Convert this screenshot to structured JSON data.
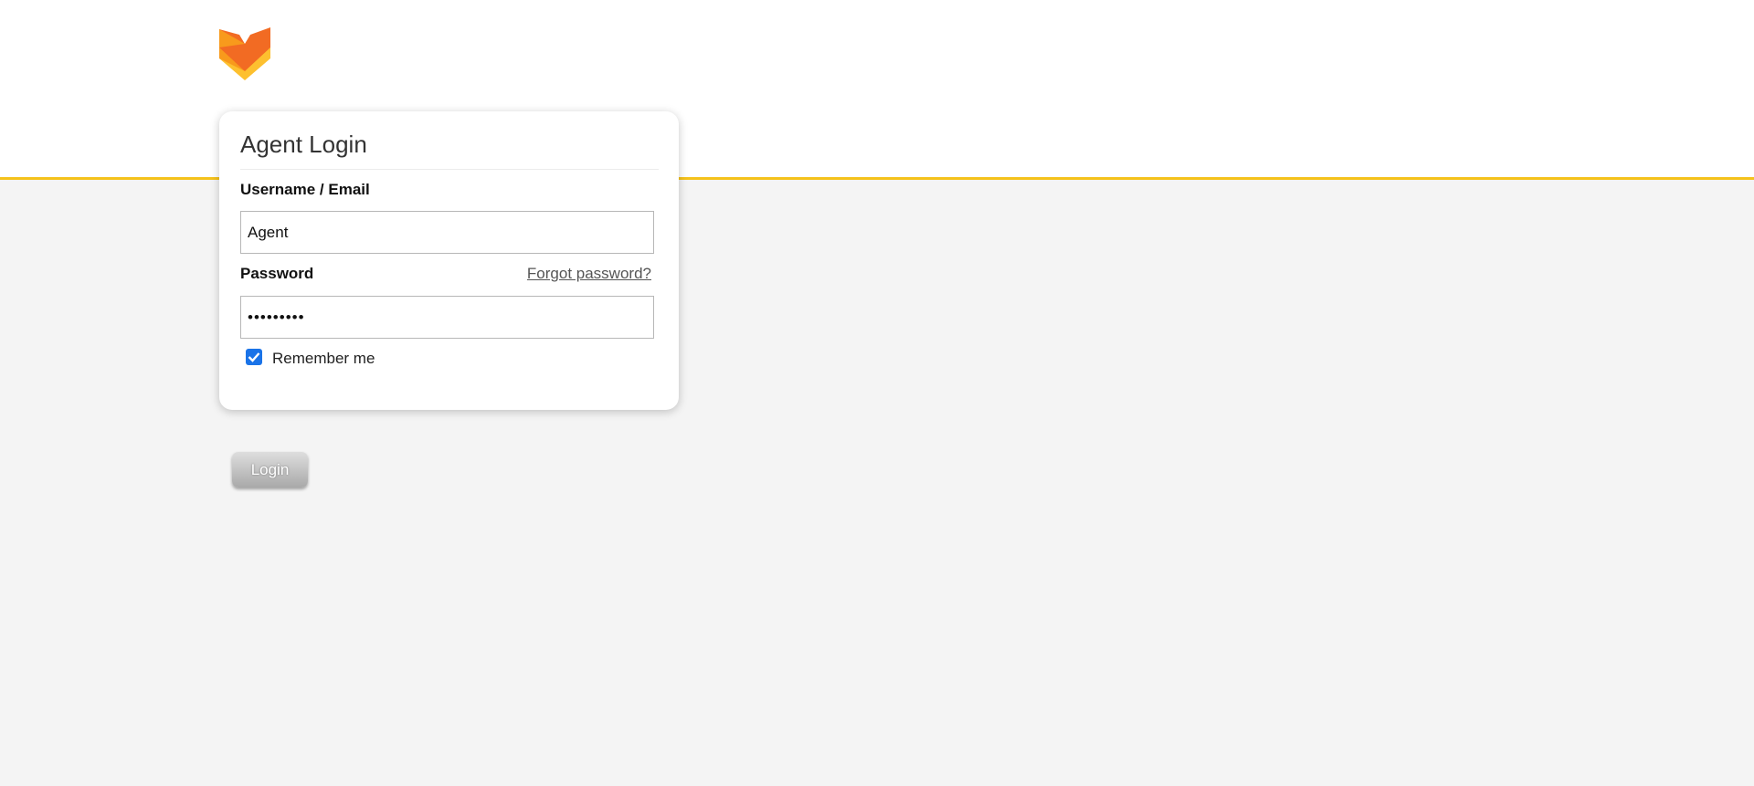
{
  "logo": {
    "icon": "fox-logo-icon",
    "colors": {
      "top": "#f26b23",
      "left": "#f89a1c",
      "bottom": "#fdc02f"
    }
  },
  "login_card": {
    "title": "Agent Login",
    "username": {
      "label": "Username / Email",
      "value": "Agent"
    },
    "password": {
      "label": "Password",
      "value": "•••••••••",
      "forgot_link": "Forgot password?"
    },
    "remember": {
      "label": "Remember me",
      "checked": true
    }
  },
  "login_button": {
    "label": "Login"
  },
  "colors": {
    "accent_line": "#f5c21b",
    "background": "#f4f4f4",
    "checkbox": "#1a73e8"
  }
}
